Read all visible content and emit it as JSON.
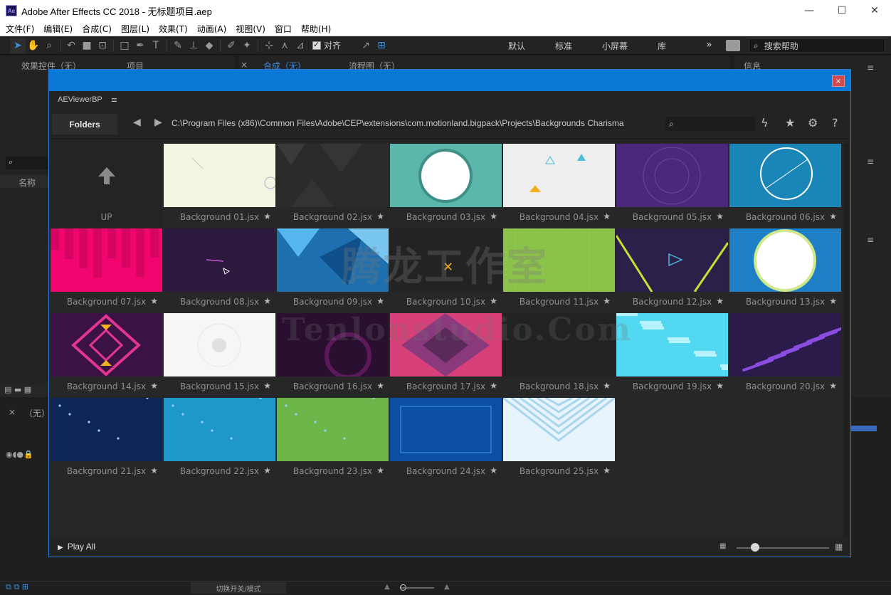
{
  "window": {
    "logo_text": "Ae",
    "title": "Adobe After Effects CC 2018 - 无标题项目.aep",
    "controls": [
      "—",
      "☐",
      "✕"
    ]
  },
  "menu": [
    "文件(F)",
    "编辑(E)",
    "合成(C)",
    "图层(L)",
    "效果(T)",
    "动画(A)",
    "视图(V)",
    "窗口",
    "帮助(H)"
  ],
  "toolbar": {
    "align_label": "对齐",
    "workspaces": [
      "默认",
      "标准",
      "小屏幕",
      "库"
    ],
    "more": "»",
    "help_search_placeholder": "搜索帮助"
  },
  "panels": {
    "left_tabs": [
      "效果控件（无）",
      "项目"
    ],
    "center_tabs": [
      "合成（无）",
      "流程图（无）"
    ],
    "right_tab": "信息",
    "project_column": "名称",
    "timeline_tab": "（无）",
    "status_toggle": "切换开关/模式"
  },
  "dialog": {
    "close": "×",
    "extension_name": "AEViewerBP",
    "menu_icon": "≡",
    "folders_button": "Folders",
    "path": "C:\\Program Files (x86)\\Common Files\\Adobe\\CEP\\extensions\\com.motionland.bigpack\\Projects\\Backgrounds Charisma",
    "up_label": "UP",
    "play_all": "Play All",
    "items": [
      {
        "label": "Background 01.jsx",
        "color": "#f3f4e1"
      },
      {
        "label": "Background 02.jsx",
        "color": "#2b2b2b"
      },
      {
        "label": "Background 03.jsx",
        "color": "#5bb7ac"
      },
      {
        "label": "Background 04.jsx",
        "color": "#eeeeee"
      },
      {
        "label": "Background 05.jsx",
        "color": "#4b2879"
      },
      {
        "label": "Background 06.jsx",
        "color": "#1a86b8"
      },
      {
        "label": "Background 07.jsx",
        "color": "#f0066e"
      },
      {
        "label": "Background 08.jsx",
        "color": "#2b1a3d"
      },
      {
        "label": "Background 09.jsx",
        "color": "#1d6fb0"
      },
      {
        "label": "Background 10.jsx",
        "color": "#232323"
      },
      {
        "label": "Background 11.jsx",
        "color": "#8bc34a"
      },
      {
        "label": "Background 12.jsx",
        "color": "#2c1f4a"
      },
      {
        "label": "Background 13.jsx",
        "color": "#1f7fc4"
      },
      {
        "label": "Background 14.jsx",
        "color": "#3a1246"
      },
      {
        "label": "Background 15.jsx",
        "color": "#f6f6f6"
      },
      {
        "label": "Background 16.jsx",
        "color": "#2a0f30"
      },
      {
        "label": "Background 17.jsx",
        "color": "#d8407a"
      },
      {
        "label": "Background 18.jsx",
        "color": "#222222"
      },
      {
        "label": "Background 19.jsx",
        "color": "#53d8f2"
      },
      {
        "label": "Background 20.jsx",
        "color": "#2b1b4a"
      },
      {
        "label": "Background 21.jsx",
        "color": "#0d2657"
      },
      {
        "label": "Background 22.jsx",
        "color": "#1e97c9"
      },
      {
        "label": "Background 23.jsx",
        "color": "#6db64a"
      },
      {
        "label": "Background 24.jsx",
        "color": "#0a4fa4"
      },
      {
        "label": "Background 25.jsx",
        "color": "#e8f4fb"
      }
    ]
  },
  "watermark": {
    "line1": "腾龙工作室",
    "line2": "Tenlonstudio.Com"
  },
  "colors": {
    "accent": "#0a78d6",
    "panel": "#232323",
    "caption_text": "#8f8f8f"
  }
}
